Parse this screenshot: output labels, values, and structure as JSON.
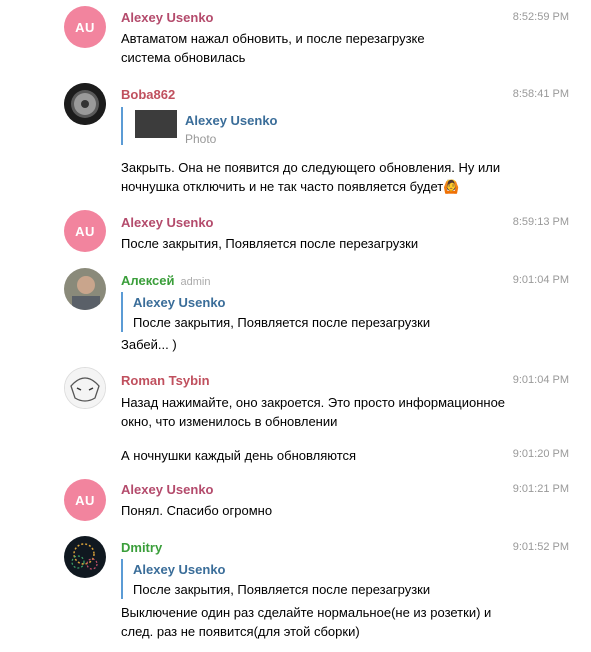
{
  "colors": {
    "name_pink": "#b44b6c",
    "name_red": "#c0505e",
    "name_green": "#3a9e3a",
    "reply_author": "#3a6d99",
    "timestamp": "#999999",
    "avatar_au": "#f2849e"
  },
  "messages": [
    {
      "author": "Alexey Usenko",
      "avatar_initials": "AU",
      "time": "8:52:59 PM",
      "text": "Автаматом нажал обновить, и после перезагрузке система обновилась"
    },
    {
      "author": "Boba862",
      "avatar_icon": "car-wheel-avatar",
      "time": "8:58:41 PM",
      "reply_author": "Alexey Usenko",
      "reply_text": "Photo",
      "text": "Закрыть. Она не появится до следующего обновления. Ну или ночнушка отключить и не так часто появляется будет🙆"
    },
    {
      "author": "Alexey Usenko",
      "avatar_initials": "AU",
      "time": "8:59:13 PM",
      "text": "После закрытия, Появляется после перезагрузки"
    },
    {
      "author": "Алексей",
      "badge": "admin",
      "avatar_icon": "person-photo-avatar",
      "time": "9:01:04 PM",
      "reply_author": "Alexey Usenko",
      "reply_text": "После закрытия, Появляется после перезагрузки",
      "text": "Забей... )"
    },
    {
      "author": "Roman Tsybin",
      "avatar_icon": "anime-sketch-avatar",
      "time": "9:01:04 PM",
      "text": "Назад нажимайте, оно закроется. Это просто информационное окно, что изменилось в обновлении"
    },
    {
      "time": "9:01:20 PM",
      "text": "А ночнушки каждый день обновляются"
    },
    {
      "author": "Alexey Usenko",
      "avatar_initials": "AU",
      "time": "9:01:21 PM",
      "text": "Понял. Спасибо огромно"
    },
    {
      "author": "Dmitry",
      "avatar_icon": "fireworks-avatar",
      "time": "9:01:52 PM",
      "reply_author": "Alexey Usenko",
      "reply_text": "После закрытия, Появляется после перезагрузки",
      "text": "Выключение один раз сделайте нормальное(не из розетки) и след. раз не появится(для этой сборки)"
    }
  ]
}
